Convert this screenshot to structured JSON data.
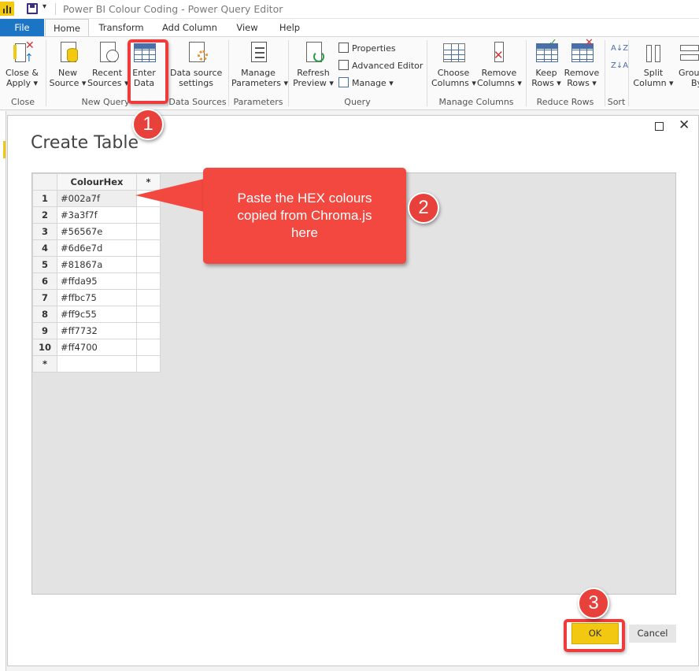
{
  "titlebar": {
    "title": "Power BI Colour Coding - Power Query Editor",
    "quick_access_dropdown": "▾"
  },
  "tabs": [
    {
      "label": "File"
    },
    {
      "label": "Home"
    },
    {
      "label": "Transform"
    },
    {
      "label": "Add Column"
    },
    {
      "label": "View"
    },
    {
      "label": "Help"
    }
  ],
  "ribbon": {
    "close_apply": {
      "line1": "Close &",
      "line2": "Apply ▾"
    },
    "new_source": {
      "line1": "New",
      "line2": "Source ▾"
    },
    "recent_sources": {
      "line1": "Recent",
      "line2": "Sources ▾"
    },
    "enter_data": {
      "line1": "Enter",
      "line2": "Data"
    },
    "data_source_settings": {
      "line1": "Data source",
      "line2": "settings"
    },
    "manage_parameters": {
      "line1": "Manage",
      "line2": "Parameters ▾"
    },
    "refresh_preview": {
      "line1": "Refresh",
      "line2": "Preview ▾"
    },
    "properties": "Properties",
    "advanced_editor": "Advanced Editor",
    "manage": "Manage ▾",
    "choose_columns": {
      "line1": "Choose",
      "line2": "Columns ▾"
    },
    "remove_columns": {
      "line1": "Remove",
      "line2": "Columns ▾"
    },
    "keep_rows": {
      "line1": "Keep",
      "line2": "Rows ▾"
    },
    "remove_rows": {
      "line1": "Remove",
      "line2": "Rows ▾"
    },
    "sort_az": "A↓Z",
    "sort_za": "Z↓A",
    "split_column": {
      "line1": "Split",
      "line2": "Column ▾"
    },
    "group_by": {
      "line1": "Grou",
      "line2": "By"
    },
    "groups": {
      "close": "Close",
      "new_query": "New Query",
      "data_sources": "Data Sources",
      "parameters": "Parameters",
      "query": "Query",
      "manage_columns": "Manage Columns",
      "reduce_rows": "Reduce Rows",
      "sort": "Sort"
    }
  },
  "dialog": {
    "title": "Create Table",
    "maximize_glyph": "",
    "close_glyph": "✕",
    "table": {
      "column_header": "ColourHex",
      "add_column_marker": "*",
      "new_row_marker": "*",
      "rows": [
        {
          "n": "1",
          "value": "#002a7f"
        },
        {
          "n": "2",
          "value": "#3a3f7f"
        },
        {
          "n": "3",
          "value": "#56567e"
        },
        {
          "n": "4",
          "value": "#6d6e7d"
        },
        {
          "n": "5",
          "value": "#81867a"
        },
        {
          "n": "6",
          "value": "#ffda95"
        },
        {
          "n": "7",
          "value": "#ffbc75"
        },
        {
          "n": "8",
          "value": "#ff9c55"
        },
        {
          "n": "9",
          "value": "#ff7732"
        },
        {
          "n": "10",
          "value": "#ff4700"
        }
      ]
    },
    "ok_label": "OK",
    "cancel_label": "Cancel"
  },
  "annotations": {
    "badge1": "1",
    "badge2": "2",
    "badge3": "3",
    "callout_line1": "Paste the HEX colours",
    "callout_line2": "copied from Chroma.js",
    "callout_line3": "here"
  },
  "colors": {
    "accent_yellow": "#f2c811",
    "file_tab_blue": "#1c74c4",
    "annotation_red": "#ee3b3b"
  }
}
